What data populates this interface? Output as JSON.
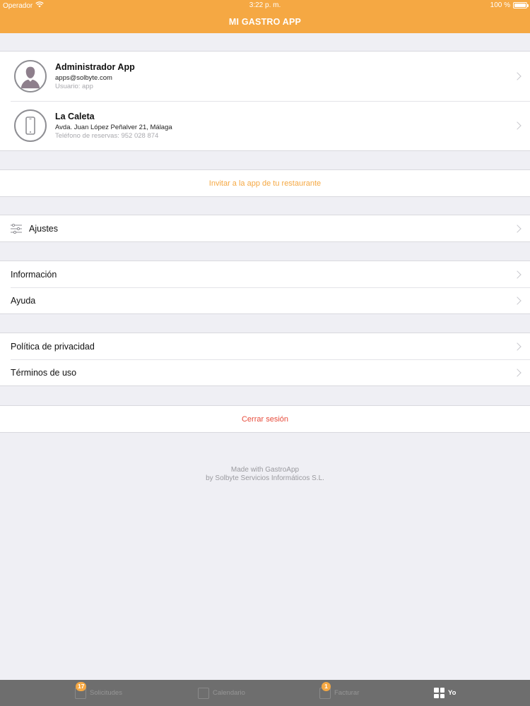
{
  "status_bar": {
    "carrier": "Operador",
    "time": "3:22 p. m.",
    "battery": "100 %"
  },
  "nav": {
    "title": "MI GASTRO APP"
  },
  "profiles": [
    {
      "title": "Administrador App",
      "line": "apps@solbyte.com",
      "sub": "Usuario: app",
      "icon": "person-silhouette-icon"
    },
    {
      "title": "La Caleta",
      "line": "Avda. Juan López Peñalver 21, Málaga",
      "sub": "Teléfono de reservas: 952 028 874",
      "icon": "phone-icon"
    }
  ],
  "invite": {
    "label": "Invitar a la app de tu restaurante"
  },
  "settings": {
    "label": "Ajustes",
    "icon": "sliders-icon"
  },
  "info_group": [
    {
      "label": "Información"
    },
    {
      "label": "Ayuda"
    }
  ],
  "legal_group": [
    {
      "label": "Política de privacidad"
    },
    {
      "label": "Términos de uso"
    }
  ],
  "logout": {
    "label": "Cerrar sesión"
  },
  "footer": {
    "line1": "Made with GastroApp",
    "line2": "by Solbyte Servicios Informáticos S.L."
  },
  "tabs": [
    {
      "label": "Solicitudes",
      "badge": "17",
      "icon": "requests-icon"
    },
    {
      "label": "Calendario",
      "icon": "calendar-icon"
    },
    {
      "label": "Facturar",
      "badge": "1",
      "icon": "invoice-icon"
    },
    {
      "label": "Yo",
      "icon": "grid-icon",
      "active": true
    }
  ],
  "colors": {
    "accent": "#f5a843",
    "destructive": "#e74c3c",
    "background": "#efeff4",
    "tab_bar": "#6e6e6e"
  }
}
